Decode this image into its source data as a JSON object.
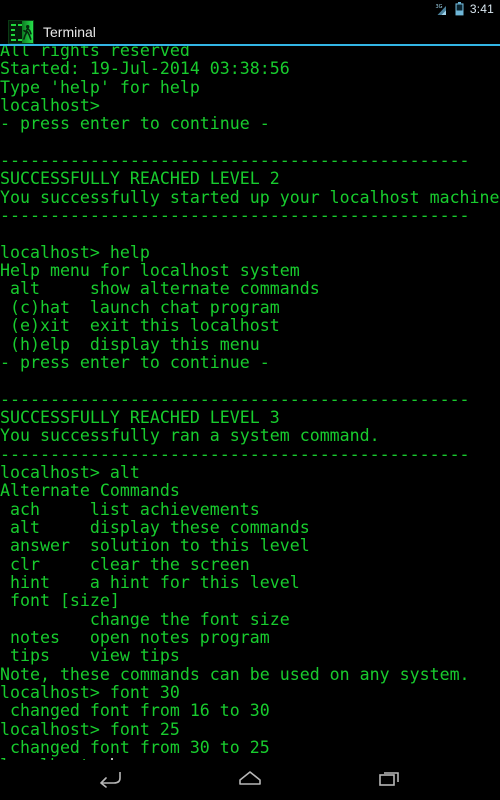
{
  "status_bar": {
    "time": "3:41",
    "signal_label": "3G",
    "icons": [
      "signal-3g-icon",
      "battery-icon"
    ]
  },
  "title_bar": {
    "app_name": "Terminal",
    "icon": "terminal-runner-icon",
    "accent_color": "#33b5e5"
  },
  "terminal": {
    "text_color": "#18cc2e",
    "background_color": "#000000",
    "cursor_color": "#b9b9b9",
    "font_size_current": 25,
    "lines": [
      "All rights reserved",
      "Started: 19-Jul-2014 03:38:56",
      "Type 'help' for help",
      "localhost>",
      "- press enter to continue -",
      "",
      "-----------------------------------------------",
      "SUCCESSFULLY REACHED LEVEL 2",
      "You successfully started up your localhost machine.",
      "-----------------------------------------------",
      "",
      "localhost> help",
      "Help menu for localhost system",
      " alt     show alternate commands",
      " (c)hat  launch chat program",
      " (e)xit  exit this localhost",
      " (h)elp  display this menu",
      "- press enter to continue -",
      "",
      "-----------------------------------------------",
      "SUCCESSFULLY REACHED LEVEL 3",
      "You successfully ran a system command.",
      "-----------------------------------------------",
      "localhost> alt",
      "Alternate Commands",
      " ach     list achievements",
      " alt     display these commands",
      " answer  solution to this level",
      " clr     clear the screen",
      " hint    a hint for this level",
      " font [size]",
      "         change the font size",
      " notes   open notes program",
      " tips    view tips",
      "Note, these commands can be used on any system.",
      "localhost> font 30",
      " changed font from 16 to 30",
      "localhost> font 25",
      " changed font from 30 to 25"
    ],
    "prompt": "localhost>",
    "cursor": "|"
  },
  "nav_bar": {
    "buttons": [
      {
        "name": "back-button",
        "icon": "back-arrow-icon"
      },
      {
        "name": "home-button",
        "icon": "home-icon"
      },
      {
        "name": "recents-button",
        "icon": "recents-icon"
      }
    ]
  }
}
